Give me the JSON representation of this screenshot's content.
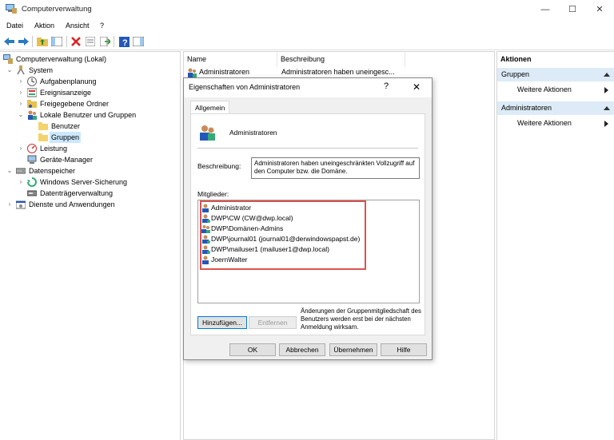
{
  "window": {
    "title": "Computerverwaltung",
    "minimize": "—",
    "maximize": "☐",
    "close": "✕"
  },
  "menu": [
    "Datei",
    "Aktion",
    "Ansicht",
    "?"
  ],
  "tree": {
    "root": "Computerverwaltung (Lokal)",
    "system": "System",
    "aufgabenplanung": "Aufgabenplanung",
    "ereignisanzeige": "Ereignisanzeige",
    "freigegebene_ordner": "Freigegebene Ordner",
    "lokale_benutzer": "Lokale Benutzer und Gruppen",
    "benutzer": "Benutzer",
    "gruppen": "Gruppen",
    "leistung": "Leistung",
    "geraete_manager": "Geräte-Manager",
    "datenspeicher": "Datenspeicher",
    "windows_server_sicherung": "Windows Server-Sicherung",
    "datentraegerverwaltung": "Datenträgerverwaltung",
    "dienste": "Dienste und Anwendungen"
  },
  "list": {
    "col_name": "Name",
    "col_beschreibung": "Beschreibung",
    "row_name": "Administratoren",
    "row_desc": "Administratoren haben uneingesc..."
  },
  "actions": {
    "header": "Aktionen",
    "section1": "Gruppen",
    "section1_item": "Weitere Aktionen",
    "section2": "Administratoren",
    "section2_item": "Weitere Aktionen"
  },
  "dialog": {
    "title": "Eigenschaften von Administratoren",
    "help": "?",
    "close": "✕",
    "tab": "Allgemein",
    "group_name": "Administratoren",
    "desc_label": "Beschreibung:",
    "desc_value": "Administratoren haben uneingeschränkten Vollzugriff auf den Computer bzw. die Domäne.",
    "members_label": "Mitglieder:",
    "members": [
      "Administrator",
      "DWP\\CW (CW@dwp.local)",
      "DWP\\Domänen-Admins",
      "DWP\\journal01 (journal01@derwindowspapst.de)",
      "DWP\\mailuser1 (mailuser1@dwp.local)",
      "JoernWalter"
    ],
    "btn_add": "Hinzufügen...",
    "btn_remove": "Entfernen",
    "note": "Änderungen der Gruppenmitgliedschaft des Benutzers werden erst bei der nächsten Anmeldung wirksam.",
    "btn_ok": "OK",
    "btn_cancel": "Abbrechen",
    "btn_apply": "Übernehmen",
    "btn_help": "Hilfe"
  },
  "colors": {
    "selection": "#cce8ff",
    "action_section": "#dcebf7",
    "highlight_box": "#d9534f",
    "accent": "#0078d7"
  }
}
